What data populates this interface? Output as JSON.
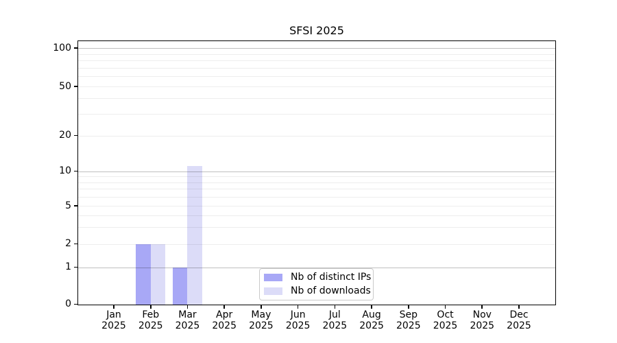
{
  "chart_data": {
    "type": "bar",
    "title": "SFSI 2025",
    "categories": [
      "Jan 2025",
      "Feb 2025",
      "Mar 2025",
      "Apr 2025",
      "May 2025",
      "Jun 2025",
      "Jul 2025",
      "Aug 2025",
      "Sep 2025",
      "Oct 2025",
      "Nov 2025",
      "Dec 2025"
    ],
    "x_tick_line1": [
      "Jan",
      "Feb",
      "Mar",
      "Apr",
      "May",
      "Jun",
      "Jul",
      "Aug",
      "Sep",
      "Oct",
      "Nov",
      "Dec"
    ],
    "x_tick_line2": "2025",
    "series": [
      {
        "name": "Nb of distinct IPs",
        "color": "#a8a8f6",
        "values": [
          0,
          2,
          1,
          0,
          0,
          0,
          0,
          0,
          0,
          0,
          0,
          0
        ]
      },
      {
        "name": "Nb of downloads",
        "color": "#dcdcf8",
        "values": [
          0,
          2,
          11,
          0,
          0,
          0,
          0,
          0,
          0,
          0,
          0,
          0
        ]
      }
    ],
    "y_axis": {
      "scale": "log-like",
      "ylim": [
        0,
        120
      ],
      "labeled_ticks": [
        0,
        1,
        2,
        5,
        10,
        20,
        50,
        100
      ],
      "major_gridlines": [
        1,
        10,
        100
      ],
      "minor_gridlines": [
        2,
        3,
        4,
        5,
        6,
        7,
        8,
        9,
        20,
        30,
        40,
        50,
        60,
        70,
        80,
        90
      ]
    },
    "legend": {
      "position": "inside-bottom-center",
      "entries": [
        "Nb of distinct IPs",
        "Nb of downloads"
      ]
    },
    "grid": true,
    "background": "#ffffff"
  }
}
